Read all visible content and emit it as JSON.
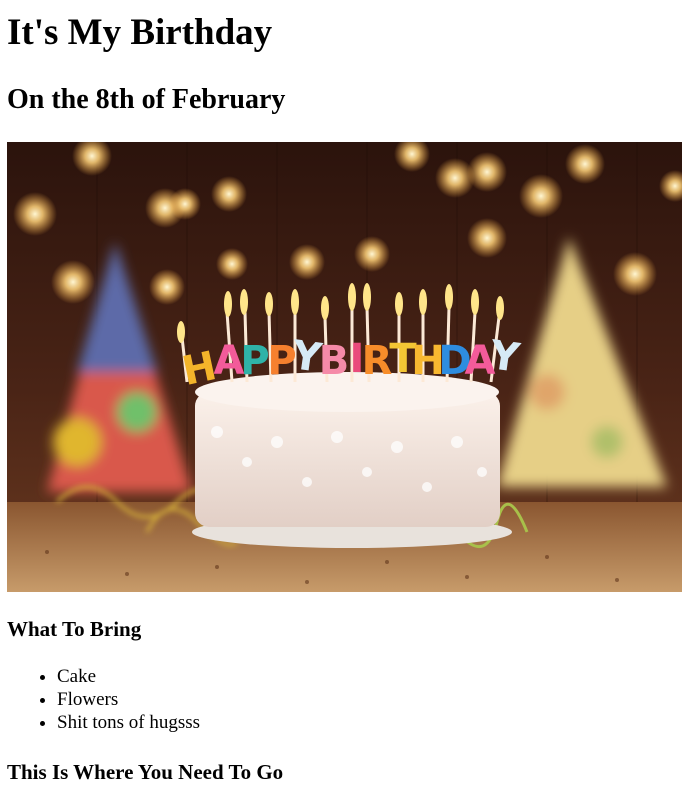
{
  "page": {
    "title": "It's My Birthday",
    "subtitle": "On the 8th of February"
  },
  "photo": {
    "caption_text": "HAPPY BIRTHDAY",
    "colors": {
      "background": "#3a1a10",
      "cake": "#f1e4dc",
      "glow": "#ffd27a"
    }
  },
  "bring_section": {
    "heading": "What To Bring",
    "items": [
      "Cake",
      "Flowers",
      "Shit tons of hugsss"
    ]
  },
  "location_section": {
    "heading": "This Is Where You Need To Go"
  }
}
